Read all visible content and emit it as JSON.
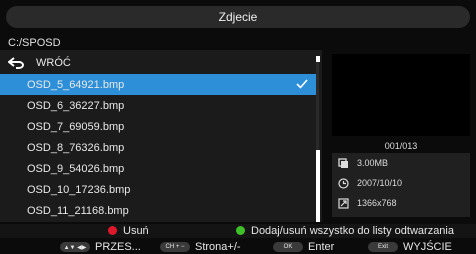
{
  "header": {
    "title": "Zdjecie"
  },
  "path": "C:/SPOSD",
  "file_list": {
    "back_label": "WRÓĆ",
    "items": [
      {
        "name": "OSD_5_64921.bmp",
        "selected": true
      },
      {
        "name": "OSD_6_36227.bmp"
      },
      {
        "name": "OSD_7_69059.bmp"
      },
      {
        "name": "OSD_8_76326.bmp"
      },
      {
        "name": "OSD_9_54026.bmp"
      },
      {
        "name": "OSD_10_17236.bmp"
      },
      {
        "name": "OSD_11_21168.bmp"
      }
    ]
  },
  "preview": {
    "counter": "001/013",
    "size": "3.00MB",
    "date": "2007/10/10",
    "resolution": "1366x768"
  },
  "status_bar": {
    "delete_label": "Usuń",
    "add_label": "Dodaj/usuń wszystko do listy odtwarzania"
  },
  "key_bar": {
    "nav_key": "▲▼ ◀▶",
    "nav_label": "PRZES...",
    "page_key": "CH + −",
    "page_label": "Strona+/-",
    "ok_key": "OK",
    "ok_label": "Enter",
    "exit_key": "Exit",
    "exit_label": "WYJŚCIE"
  },
  "colors": {
    "selection": "#2d8fd8",
    "red_button": "#e0182c",
    "green_button": "#3fbf2a"
  }
}
